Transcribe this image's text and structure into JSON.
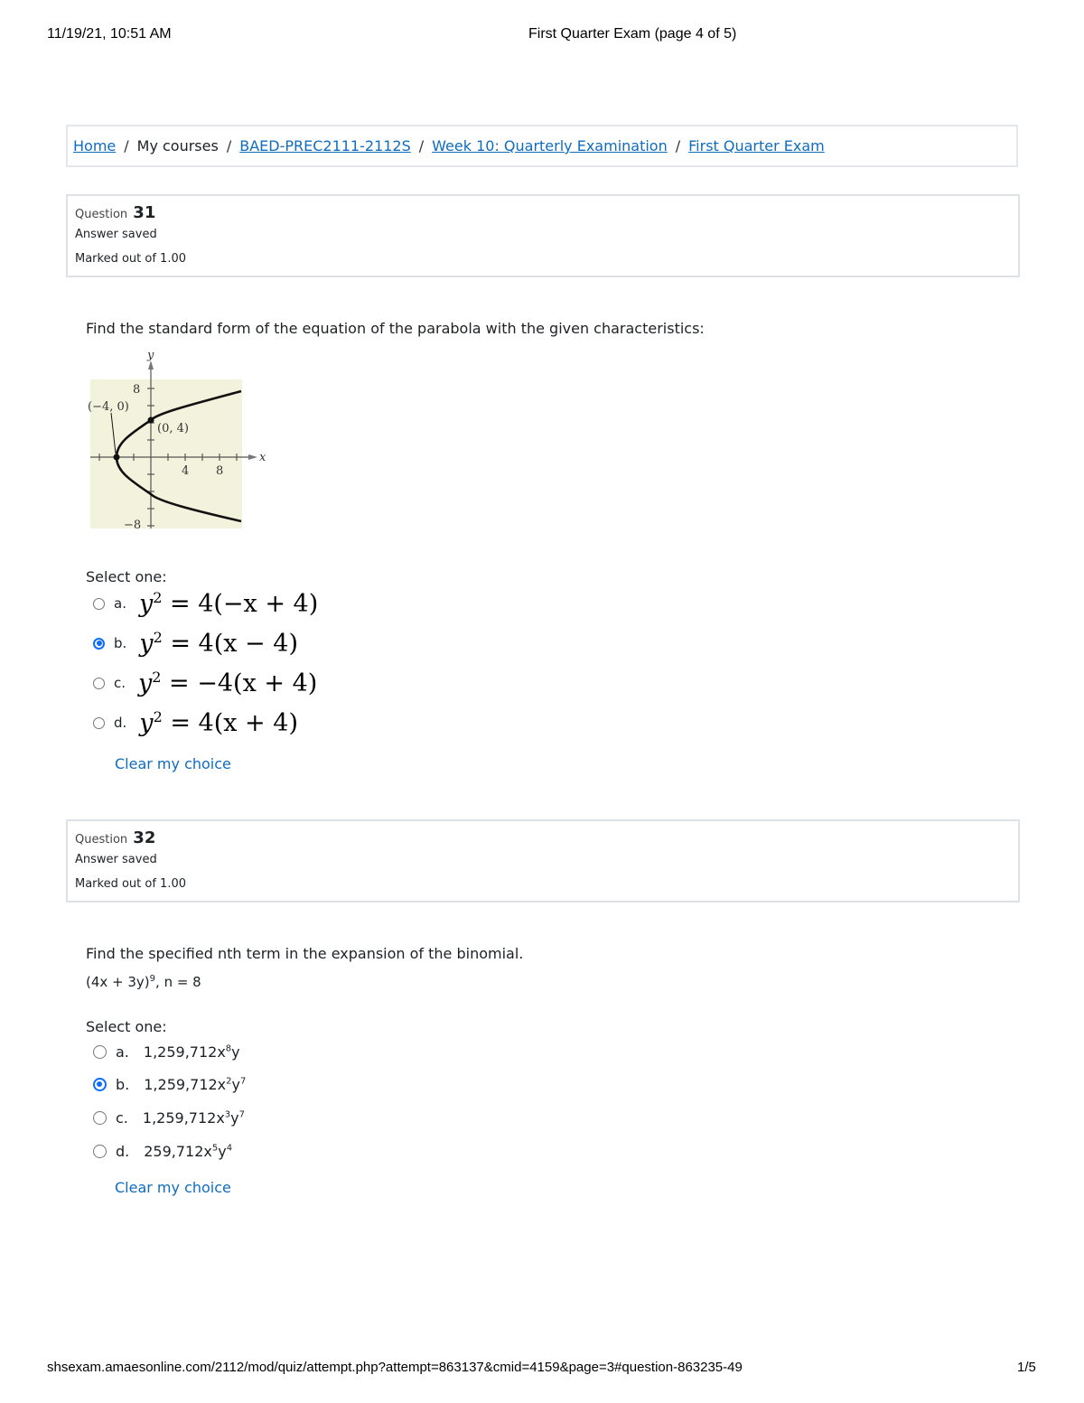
{
  "print_header": {
    "datetime": "11/19/21, 10:51 AM",
    "title": "First Quarter Exam (page 4 of 5)"
  },
  "breadcrumb": [
    {
      "label": "Home",
      "link": true
    },
    {
      "label": "My courses",
      "link": false
    },
    {
      "label": "BAED-PREC2111-2112S",
      "link": true
    },
    {
      "label": "Week 10: Quarterly Examination",
      "link": true
    },
    {
      "label": "First Quarter Exam",
      "link": true
    }
  ],
  "breadcrumb_sep": "/",
  "questions": [
    {
      "label": "Question",
      "number": "31",
      "state": "Answer saved",
      "grade": "Marked out of 1.00",
      "text": "Find the standard form of the equation of the parabola with the given characteristics:",
      "graph": {
        "y_label": "y",
        "x_label": "x",
        "y_ticks": [
          "8",
          "−8"
        ],
        "x_ticks": [
          "4",
          "8"
        ],
        "vertex_label": "(−4, 0)",
        "point_label": "(0, 4)",
        "background": "#f3f2dc"
      },
      "select_label": "Select one:",
      "options": [
        {
          "letter": "a.",
          "lhs": "y",
          "exp": "2",
          "rhs": " = 4(−x + 4)",
          "checked": false
        },
        {
          "letter": "b.",
          "lhs": "y",
          "exp": "2",
          "rhs": " = 4(x − 4)",
          "checked": true
        },
        {
          "letter": "c.",
          "lhs": "y",
          "exp": "2",
          "rhs": " = −4(x + 4)",
          "checked": false
        },
        {
          "letter": "d.",
          "lhs": "y",
          "exp": "2",
          "rhs": " = 4(x + 4)",
          "checked": false
        }
      ],
      "clear_label": "Clear my choice"
    },
    {
      "label": "Question",
      "number": "32",
      "state": "Answer saved",
      "grade": "Marked out of 1.00",
      "text": "Find the specified nth term in the expansion of the binomial.",
      "expr": {
        "base": "(4x + 3y)",
        "exp": "9",
        "rest": ", n = 8"
      },
      "select_label": "Select one:",
      "options": [
        {
          "letter": "a.",
          "coef": "1,259,712x",
          "xexp": "8",
          "y": "y",
          "yexp": "",
          "checked": false
        },
        {
          "letter": "b.",
          "coef": "1,259,712x",
          "xexp": "2",
          "y": "y",
          "yexp": "7",
          "checked": true
        },
        {
          "letter": "c.",
          "coef": "1,259,712x",
          "xexp": "3",
          "y": "y",
          "yexp": "7",
          "checked": false
        },
        {
          "letter": "d.",
          "coef": "259,712x",
          "xexp": "5",
          "y": "y",
          "yexp": "4",
          "checked": false
        }
      ],
      "clear_label": "Clear my choice"
    }
  ],
  "print_footer": {
    "url": "shsexam.amaesonline.com/2112/mod/quiz/attempt.php?attempt=863137&cmid=4159&page=3#question-863235-49",
    "page": "1/5"
  },
  "colors": {
    "link": "#0f6cbf",
    "radio_checked": "#0d6efd",
    "border": "#dee2e6"
  }
}
